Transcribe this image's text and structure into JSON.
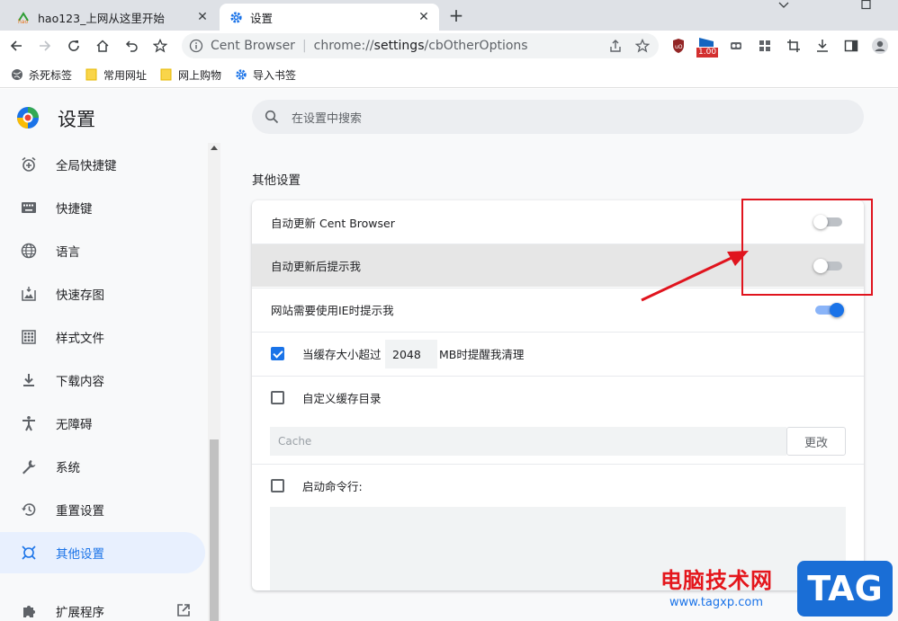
{
  "tabs": [
    {
      "title": "hao123_上网从这里开始",
      "active": false
    },
    {
      "title": "设置",
      "active": true
    }
  ],
  "omnibox": {
    "site": "Cent Browser",
    "separator": "|",
    "url_scheme": "chrome://",
    "url_host": "settings",
    "url_path": "/cbOtherOptions"
  },
  "extension_badge": "1.00",
  "bookmarks": [
    "杀死标签",
    "常用网址",
    "网上购物",
    "导入书签"
  ],
  "settings": {
    "title": "设置",
    "search_placeholder": "在设置中搜索",
    "nav": [
      {
        "label": "全局快捷键",
        "icon": "alarm-plus-icon"
      },
      {
        "label": "快捷键",
        "icon": "keyboard-icon"
      },
      {
        "label": "语言",
        "icon": "globe-icon"
      },
      {
        "label": "快速存图",
        "icon": "image-save-icon"
      },
      {
        "label": "样式文件",
        "icon": "grid-file-icon"
      },
      {
        "label": "下载内容",
        "icon": "download-icon"
      },
      {
        "label": "无障碍",
        "icon": "accessibility-icon"
      },
      {
        "label": "系统",
        "icon": "wrench-icon"
      },
      {
        "label": "重置设置",
        "icon": "history-icon"
      },
      {
        "label": "其他设置",
        "icon": "other-settings-icon",
        "selected": true
      },
      {
        "label": "扩展程序",
        "icon": "puzzle-icon"
      }
    ],
    "section_title": "其他设置",
    "rows": {
      "auto_update": {
        "label": "自动更新 Cent Browser",
        "on": false
      },
      "notify_after_update": {
        "label": "自动更新后提示我",
        "on": false
      },
      "ie_notify": {
        "label": "网站需要使用IE时提示我",
        "on": true
      },
      "cache_warn": {
        "label_before": "当缓存大小超过",
        "value": "2048",
        "label_after": "MB时提醒我清理",
        "checked": true
      },
      "custom_cache_dir": {
        "label": "自定义缓存目录",
        "checked": false,
        "placeholder": "Cache",
        "button": "更改"
      },
      "cmdline": {
        "label": "启动命令行:",
        "checked": false
      }
    }
  },
  "watermark": {
    "text": "电脑技术网",
    "url": "www.tagxp.com",
    "tag": "TAG"
  },
  "colors": {
    "accent": "#1a73e8",
    "annotation": "#e0141e"
  }
}
